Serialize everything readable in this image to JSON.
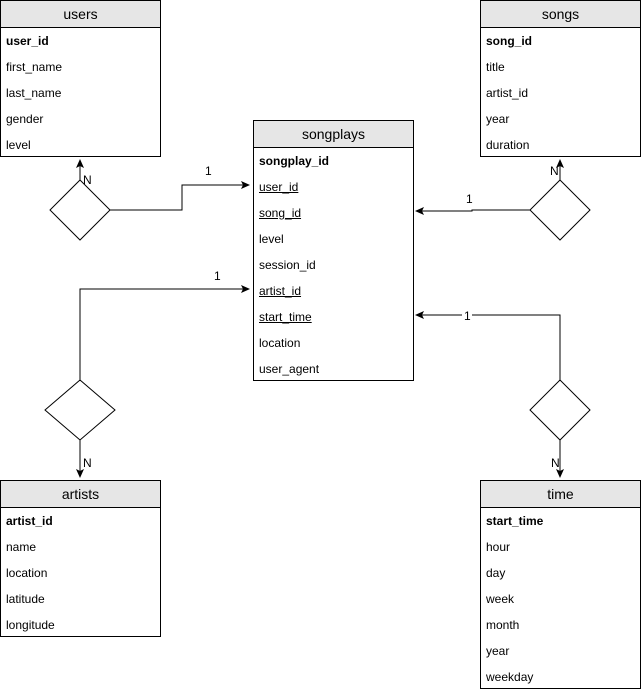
{
  "entities": {
    "users": {
      "title": "users",
      "fields": [
        {
          "name": "user_id",
          "kind": "pk"
        },
        {
          "name": "first_name",
          "kind": "plain"
        },
        {
          "name": "last_name",
          "kind": "plain"
        },
        {
          "name": "gender",
          "kind": "plain"
        },
        {
          "name": "level",
          "kind": "plain"
        }
      ]
    },
    "songs": {
      "title": "songs",
      "fields": [
        {
          "name": "song_id",
          "kind": "pk"
        },
        {
          "name": "title",
          "kind": "plain"
        },
        {
          "name": "artist_id",
          "kind": "plain"
        },
        {
          "name": "year",
          "kind": "plain"
        },
        {
          "name": "duration",
          "kind": "plain"
        }
      ]
    },
    "songplays": {
      "title": "songplays",
      "fields": [
        {
          "name": "songplay_id",
          "kind": "pk"
        },
        {
          "name": "user_id",
          "kind": "fk"
        },
        {
          "name": "song_id",
          "kind": "fk"
        },
        {
          "name": "level",
          "kind": "plain"
        },
        {
          "name": "session_id",
          "kind": "plain"
        },
        {
          "name": "artist_id",
          "kind": "fk"
        },
        {
          "name": "start_time",
          "kind": "fk"
        },
        {
          "name": "location",
          "kind": "plain"
        },
        {
          "name": "user_agent",
          "kind": "plain"
        }
      ]
    },
    "artists": {
      "title": "artists",
      "fields": [
        {
          "name": "artist_id",
          "kind": "pk"
        },
        {
          "name": "name",
          "kind": "plain"
        },
        {
          "name": "location",
          "kind": "plain"
        },
        {
          "name": "latitude",
          "kind": "plain"
        },
        {
          "name": "longitude",
          "kind": "plain"
        }
      ]
    },
    "time": {
      "title": "time",
      "fields": [
        {
          "name": "start_time",
          "kind": "pk"
        },
        {
          "name": "hour",
          "kind": "plain"
        },
        {
          "name": "day",
          "kind": "plain"
        },
        {
          "name": "week",
          "kind": "plain"
        },
        {
          "name": "month",
          "kind": "plain"
        },
        {
          "name": "year",
          "kind": "plain"
        },
        {
          "name": "weekday",
          "kind": "plain"
        }
      ]
    }
  },
  "relationships": [
    {
      "from": "users",
      "to": "songplays",
      "to_field": "user_id",
      "one_label": "1",
      "many_label": "N"
    },
    {
      "from": "songs",
      "to": "songplays",
      "to_field": "song_id",
      "one_label": "1",
      "many_label": "N"
    },
    {
      "from": "artists",
      "to": "songplays",
      "to_field": "artist_id",
      "one_label": "1",
      "many_label": "N"
    },
    {
      "from": "time",
      "to": "songplays",
      "to_field": "start_time",
      "one_label": "1",
      "many_label": "N"
    }
  ]
}
